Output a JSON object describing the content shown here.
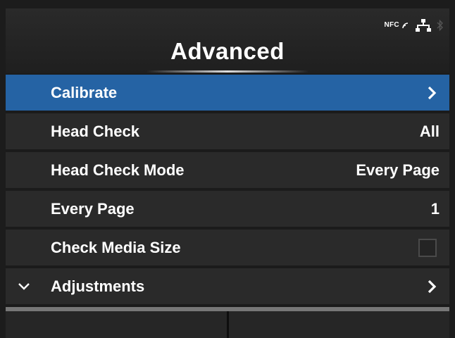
{
  "header": {
    "title": "Advanced",
    "nfc_label": "NFC"
  },
  "status_icons": [
    "nfc-icon",
    "network-icon",
    "bluetooth-icon"
  ],
  "menu": {
    "items": [
      {
        "label": "Calibrate",
        "value": "",
        "control": "chevron-right-icon",
        "selected": true
      },
      {
        "label": "Head Check",
        "value": "All",
        "control": "value"
      },
      {
        "label": "Head Check Mode",
        "value": "Every Page",
        "control": "value"
      },
      {
        "label": "Every Page",
        "value": "1",
        "control": "value"
      },
      {
        "label": "Check Media Size",
        "value": "",
        "control": "checkbox",
        "checked": false
      },
      {
        "label": "Adjustments",
        "value": "",
        "control": "chevron-right-icon",
        "expand_icon": "chevron-down-icon"
      }
    ]
  },
  "colors": {
    "selected_row": "#2563a4",
    "row_bg": "#2a2a2a",
    "background": "#1b1b1b"
  }
}
